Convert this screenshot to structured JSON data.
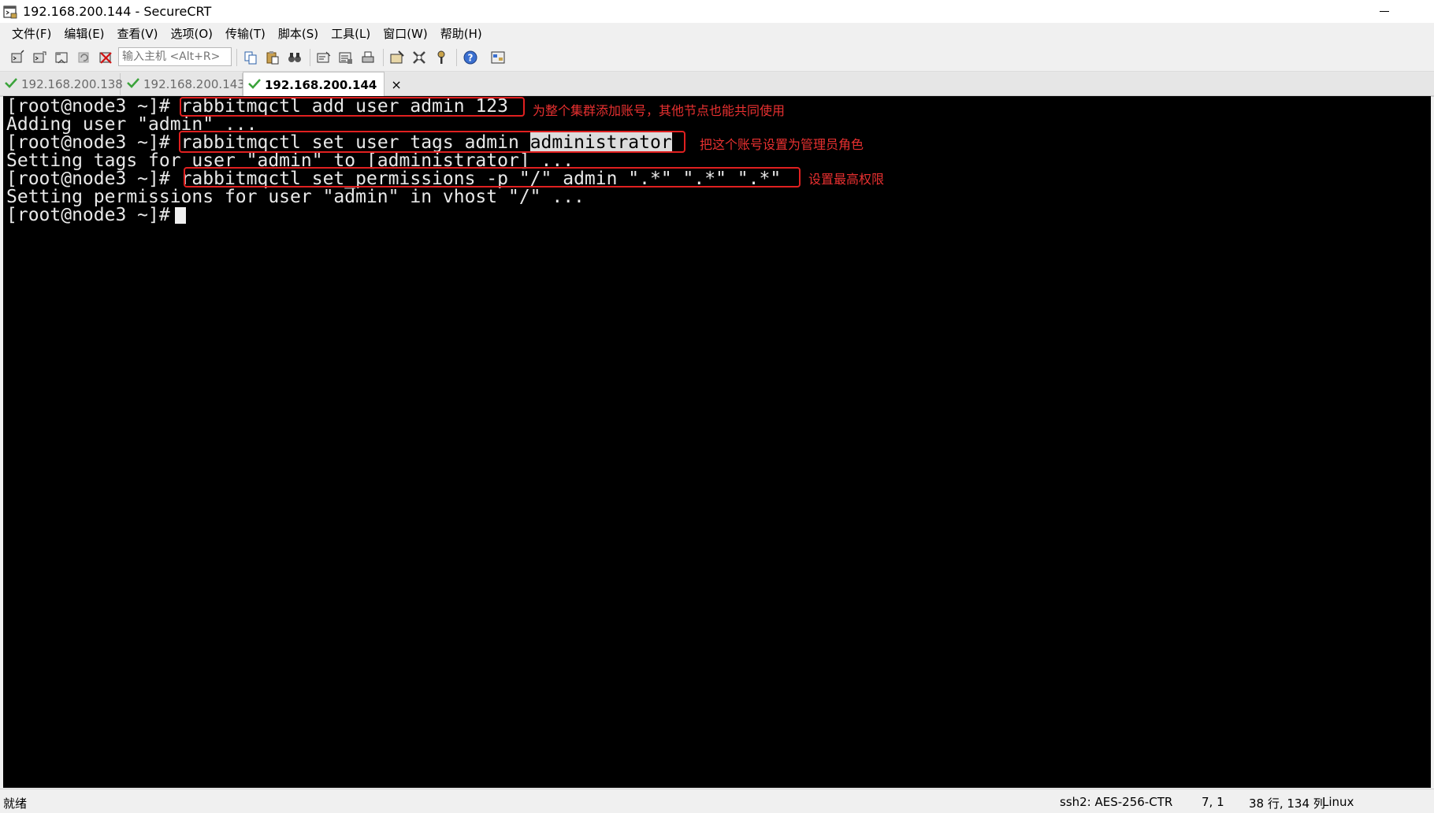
{
  "window": {
    "title": "192.168.200.144 - SecureCRT"
  },
  "menu": [
    "文件(F)",
    "编辑(E)",
    "查看(V)",
    "选项(O)",
    "传输(T)",
    "脚本(S)",
    "工具(L)",
    "窗口(W)",
    "帮助(H)"
  ],
  "toolbar": {
    "quick_connect_placeholder": "输入主机 <Alt+R>"
  },
  "tabs": [
    {
      "label": "192.168.200.138",
      "active": false
    },
    {
      "label": "192.168.200.143",
      "active": false
    },
    {
      "label": "192.168.200.144",
      "active": true,
      "close": "×"
    }
  ],
  "terminal": {
    "prompt": "[root@node3 ~]#",
    "lines": [
      {
        "prompt": "[root@node3 ~]#",
        "cmd": " rabbitmqctl add_user admin 123"
      },
      {
        "text": "Adding user \"admin\" ..."
      },
      {
        "prompt": "[root@node3 ~]#",
        "cmd": " rabbitmqctl set_user_tags admin ",
        "selected": "administrator"
      },
      {
        "text": "Setting tags for user \"admin\" to [administrator] ..."
      },
      {
        "prompt": "[root@node3 ~]#",
        "cmd": " rabbitmqctl set_permissions -p \"/\" admin \".*\" \".*\" \".*\""
      },
      {
        "text": "Setting permissions for user \"admin\" in vhost \"/\" ..."
      },
      {
        "prompt": "[root@node3 ~]#"
      }
    ],
    "annotations": [
      "为整个集群添加账号，其他节点也能共同使用",
      "把这个账号设置为管理员角色",
      "设置最高权限"
    ]
  },
  "status": {
    "left": "就绪",
    "encryption": "ssh2: AES-256-CTR",
    "cursor_pos": "7,  1",
    "size": "38 行, 134 列",
    "os": "Linux"
  },
  "colors": {
    "annotation": "#e02020",
    "terminal_bg": "#000000",
    "terminal_fg": "#e8e8e8"
  }
}
